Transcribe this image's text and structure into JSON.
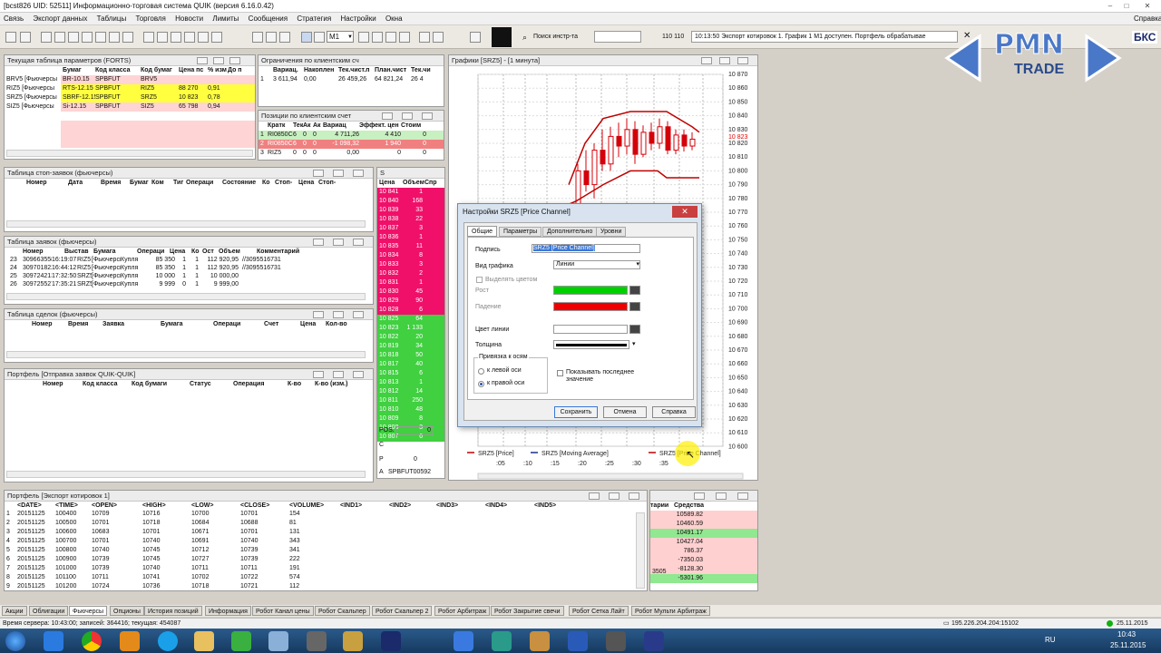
{
  "window": {
    "title": "[bcst826 UID: 52511] Информационно-торговая система QUIK (версия 6.16.0.42)"
  },
  "menu": {
    "items": [
      "Связь",
      "Экспорт данных",
      "Таблицы",
      "Торговля",
      "Новости",
      "Лимиты",
      "Сообщения",
      "Стратегия",
      "Настройки",
      "Окна"
    ],
    "help": "Справка"
  },
  "toolbar": {
    "interval": "M1",
    "search_label": "Поиск инстр-та",
    "counter": "110 110",
    "status_msg": "10:13:50  Экспорт котировок 1. График 1 M1 доступен. Портфель обрабатывае"
  },
  "logo": {
    "name": "PMN",
    "sub": "TRADE",
    "partial": "БКС"
  },
  "params": {
    "title": "Текущая таблица параметров (FORTS)",
    "headers": [
      "",
      "Бумаг",
      "Код класса",
      "Код бумаг",
      "Цена пс",
      "% изм",
      "До п"
    ],
    "rows": [
      [
        "BRV5 [Фьючерсы",
        "BR-10.15",
        "SPBFUT",
        "BRV5",
        "",
        "",
        ""
      ],
      [
        "RIZ5 [Фьючерсы",
        "RTS-12.15",
        "SPBFUT",
        "RIZ5",
        "88 270",
        "0,91",
        ""
      ],
      [
        "SRZ5 [Фьючерсы",
        "SBRF-12.15",
        "SPBFUT",
        "SRZ5",
        "10 823",
        "0,78",
        ""
      ],
      [
        "SIZ5 [Фьючерсы",
        "Si-12.15",
        "SPBFUT",
        "SIZ5",
        "65 798",
        "0,94",
        ""
      ]
    ]
  },
  "limits": {
    "title": "Ограничения по клиентским сч",
    "headers": [
      "",
      "Вариац.",
      "Накоплен",
      "Тек.чист.п",
      "План.чист",
      "Тек.чи"
    ],
    "rows": [
      [
        "1",
        "3 611,94",
        "0,00",
        "26 459,26",
        "64 821,24",
        "26 4"
      ]
    ]
  },
  "positions": {
    "title": "Позиции по клиентским счет",
    "headers": [
      "",
      "Кратк",
      "Тек",
      "Ак",
      "Ак",
      "Вариац",
      "Эффект. цен",
      "Стоим"
    ],
    "rows": [
      [
        "1",
        "RI0850C",
        "6",
        "0",
        "0",
        "4 711,26",
        "4 410",
        "0"
      ],
      [
        "2",
        "RI0850C",
        "6",
        "0",
        "0",
        "-1 098,32",
        "1 940",
        "0"
      ],
      [
        "3",
        "RIZ5",
        "0",
        "0",
        "0",
        "0,00",
        "0",
        "0"
      ]
    ]
  },
  "stops": {
    "title": "Таблица стоп-заявок (фьючерсы)",
    "headers": [
      "Номер",
      "Дата",
      "Время",
      "Бумаг",
      "Ком",
      "Тиг",
      "Операци",
      "Состояние",
      "Ко",
      "Стоп-",
      "Цена",
      "Стоп-"
    ]
  },
  "orders": {
    "title": "Таблица заявок (фьючерсы)",
    "headers": [
      "",
      "Номер",
      "Выстав",
      "Бумага",
      "Операци",
      "Цена",
      "Ко",
      "Ост",
      "Объем",
      "Комментарий"
    ],
    "rows": [
      [
        "23",
        "3096635585",
        "16:19:07",
        "RIZ5",
        "[Фьючерсы]",
        "Купля",
        "85 350",
        "1",
        "1",
        "112 920,95",
        "//3095516731"
      ],
      [
        "24",
        "3097018220",
        "16:44:12",
        "RIZ5",
        "[Фьючерсы]",
        "Купля",
        "85 350",
        "1",
        "1",
        "112 920,95",
        "//3095516731"
      ],
      [
        "25",
        "3097242132",
        "17:32:50",
        "SRZ5",
        "[Фьючерсы]",
        "Купля",
        "10 000",
        "1",
        "1",
        "10 000,00",
        ""
      ],
      [
        "26",
        "3097255272",
        "17:35:21",
        "SRZ5",
        "[Фьючерсы]",
        "Купля",
        "9 999",
        "0",
        "1",
        "9 999,00",
        ""
      ]
    ]
  },
  "deals": {
    "title": "Таблица сделок (фьючерсы)",
    "headers": [
      "Номер",
      "Время",
      "Заявка",
      "Бумага",
      "Операци",
      "Счет",
      "Цена",
      "Кол-во"
    ]
  },
  "portfolio": {
    "title": "Портфель [Отправка заявок QUIK-QUIK]",
    "headers": [
      "Номер",
      "Код класса",
      "Код бумаги",
      "Статус",
      "Операция",
      "К-во",
      "К-во (изм.)"
    ]
  },
  "book": {
    "title": "S",
    "headers": [
      "Цена",
      "Объем",
      "Спр"
    ],
    "rows": [
      [
        "10 841",
        "1",
        ""
      ],
      [
        "10 840",
        "168",
        ""
      ],
      [
        "10 839",
        "33",
        ""
      ],
      [
        "10 838",
        "22",
        ""
      ],
      [
        "10 837",
        "3",
        ""
      ],
      [
        "10 836",
        "1",
        ""
      ],
      [
        "10 835",
        "11",
        ""
      ],
      [
        "10 834",
        "8",
        ""
      ],
      [
        "10 833",
        "3",
        ""
      ],
      [
        "10 832",
        "2",
        ""
      ],
      [
        "10 831",
        "1",
        ""
      ],
      [
        "10 830",
        "45",
        ""
      ],
      [
        "10 829",
        "90",
        ""
      ],
      [
        "10 828",
        "6",
        ""
      ],
      [
        "10 825",
        "64",
        ""
      ],
      [
        "10 823",
        "1 133",
        ""
      ],
      [
        "10 822",
        "20",
        ""
      ],
      [
        "10 819",
        "34",
        ""
      ],
      [
        "10 818",
        "50",
        ""
      ],
      [
        "10 817",
        "40",
        ""
      ],
      [
        "10 815",
        "6",
        ""
      ],
      [
        "10 813",
        "1",
        ""
      ],
      [
        "10 812",
        "14",
        ""
      ],
      [
        "10 811",
        "250",
        ""
      ],
      [
        "10 810",
        "48",
        ""
      ],
      [
        "10 809",
        "8",
        ""
      ],
      [
        "10 808",
        "3",
        ""
      ],
      [
        "10 807",
        "6",
        ""
      ]
    ],
    "pos_label": "POS.",
    "pos_value": "0",
    "c_label": "C",
    "p_label": "P",
    "p_value": "0",
    "a_label": "A",
    "a_value": "SPBFUT00592"
  },
  "chart": {
    "title": "Графики [SRZ5] - [1 минута]",
    "yticks": [
      "10 870",
      "10 860",
      "10 850",
      "10 840",
      "10 830",
      "10 820",
      "10 810",
      "10 800",
      "10 790",
      "10 780",
      "10 770",
      "10 760",
      "10 750",
      "10 740",
      "10 730",
      "10 720",
      "10 710",
      "10 700",
      "10 690",
      "10 680",
      "10 670",
      "10 660",
      "10 650",
      "10 640",
      "10 630",
      "10 620",
      "10 610",
      "10 600"
    ],
    "current_price": "10 823",
    "xticks": [
      ":05",
      ":10",
      ":15",
      ":20",
      ":25",
      ":30",
      ":35"
    ],
    "legend": [
      "SRZ5 [Price]",
      "SRZ5 [Moving Average]",
      "SRZ5 [Price Channel]"
    ],
    "colors": {
      "up": "#d4000a",
      "down": "#d4000a",
      "channel": "#c00000",
      "ma": "#1a2f8c"
    }
  },
  "dialog": {
    "title": "Настройки SRZ5 [Price Channel]",
    "tabs": [
      "Общие",
      "Параметры",
      "Дополнительно",
      "Уровни"
    ],
    "label_caption": "Подпись",
    "label_value": "SRZ5 [Price Channel]",
    "type_caption": "Вид графика",
    "type_value": "Линии",
    "highlight_caption": "Выделять цветом",
    "rise_caption": "Рост",
    "fall_caption": "Падение",
    "line_color_caption": "Цвет линии",
    "thickness_caption": "Толщина",
    "axis_group": "Привязка к осям",
    "left_axis": "к левой оси",
    "right_axis": "к правой оси",
    "show_last": "Показывать последнее значение",
    "save": "Сохранить",
    "cancel": "Отмена",
    "help": "Справка",
    "colors": {
      "rise": "#00d000",
      "fall": "#ee0000",
      "line": "#ffffff"
    }
  },
  "export": {
    "title": "Портфель [Экспорт котировок 1]",
    "headers": [
      "",
      "<DATE>",
      "<TIME>",
      "<OPEN>",
      "<HIGH>",
      "<LOW>",
      "<CLOSE>",
      "<VOLUME>",
      "<IND1>",
      "<IND2>",
      "<IND3>",
      "<IND4>",
      "<IND5>"
    ],
    "rows": [
      [
        "1",
        "20151125",
        "100400",
        "10709",
        "10716",
        "10700",
        "10701",
        "154"
      ],
      [
        "2",
        "20151125",
        "100500",
        "10701",
        "10718",
        "10684",
        "10688",
        "81"
      ],
      [
        "3",
        "20151125",
        "100600",
        "10683",
        "10701",
        "10671",
        "10701",
        "131"
      ],
      [
        "4",
        "20151125",
        "100700",
        "10701",
        "10740",
        "10691",
        "10740",
        "343"
      ],
      [
        "5",
        "20151125",
        "100800",
        "10740",
        "10745",
        "10712",
        "10739",
        "341"
      ],
      [
        "6",
        "20151125",
        "100900",
        "10739",
        "10745",
        "10727",
        "10739",
        "222"
      ],
      [
        "7",
        "20151125",
        "101000",
        "10739",
        "10740",
        "10711",
        "10711",
        "191"
      ],
      [
        "8",
        "20151125",
        "101100",
        "10711",
        "10741",
        "10702",
        "10722",
        "574"
      ],
      [
        "9",
        "20151125",
        "101200",
        "10724",
        "10736",
        "10718",
        "10721",
        "112"
      ]
    ]
  },
  "funds": {
    "header_a": "тарии",
    "header_b": "Средства",
    "values": [
      "10589.82",
      "10460.59",
      "10491.17",
      "10427.04",
      "786.37",
      "-7350.03",
      "-8128.30",
      "-5301.96"
    ],
    "extra": "3505"
  },
  "bottom_tabs": [
    "Акции",
    "Облигации",
    "Фьючерсы",
    "Опционы",
    "История позиций",
    "Информация",
    "Робот Канал цены",
    "Робот Скальпер",
    "Робот Скальпер 2",
    "Робот Арбитраж",
    "Робот Закрытие свечи",
    "Робот Сетка Лайт",
    "Робот Мульти Арбитраж"
  ],
  "status": {
    "text": "Время сервера: 10:43:00; записей: 364416; текущая: 454087",
    "ip": "195.226.204.204:15102",
    "date": "25.11.2015"
  },
  "taskbar": {
    "lang": "RU",
    "time": "10:43",
    "date": "25.11.2015"
  }
}
